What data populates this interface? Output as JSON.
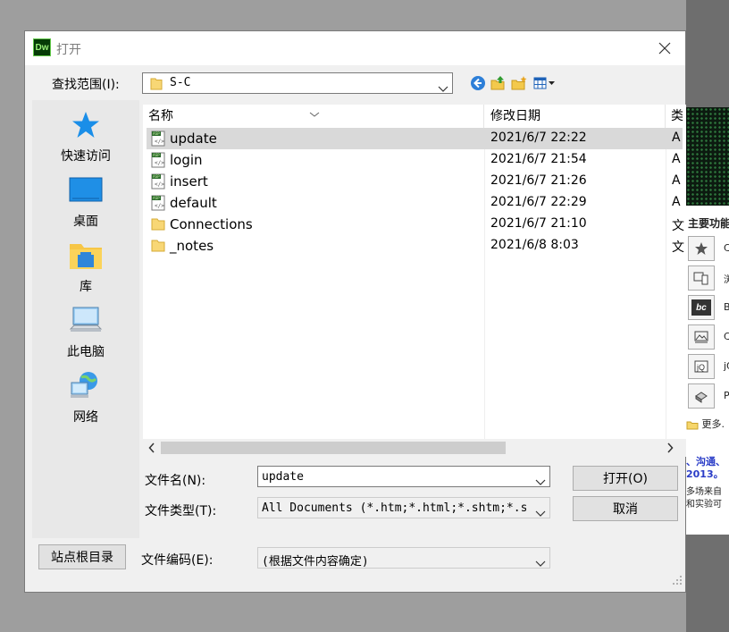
{
  "dialog": {
    "logo_text": "Dw",
    "title": "打开",
    "look_in_label": "查找范围(I):",
    "look_in_value": "S-C",
    "places": [
      {
        "label": "快速访问",
        "icon": "star-icon"
      },
      {
        "label": "桌面",
        "icon": "desktop-icon"
      },
      {
        "label": "库",
        "icon": "library-icon"
      },
      {
        "label": "此电脑",
        "icon": "computer-icon"
      },
      {
        "label": "网络",
        "icon": "network-icon"
      }
    ],
    "columns": {
      "name": "名称",
      "modified": "修改日期",
      "type": "类"
    },
    "files": [
      {
        "name": "update",
        "date": "2021/6/7 22:22",
        "type": "A",
        "kind": "asp-file",
        "selected": true
      },
      {
        "name": "login",
        "date": "2021/6/7 21:54",
        "type": "A",
        "kind": "asp-file",
        "selected": false
      },
      {
        "name": "insert",
        "date": "2021/6/7 21:26",
        "type": "A",
        "kind": "asp-file",
        "selected": false
      },
      {
        "name": "default",
        "date": "2021/6/7 22:29",
        "type": "A",
        "kind": "asp-file",
        "selected": false
      },
      {
        "name": "Connections",
        "date": "2021/6/7 21:10",
        "type": "文",
        "kind": "folder",
        "selected": false
      },
      {
        "name": "_notes",
        "date": "2021/6/8 8:03",
        "type": "文",
        "kind": "folder",
        "selected": false
      }
    ],
    "filename_label": "文件名(N):",
    "filename_value": "update",
    "filetype_label": "文件类型(T):",
    "filetype_value": "All Documents (*.htm;*.html;*.shtm;*.s",
    "encoding_label": "文件编码(E):",
    "encoding_value": "(根据文件内容确定)",
    "open_button": "打开(O)",
    "cancel_button": "取消",
    "site_root_button": "站点根目录"
  },
  "background_app": {
    "panel_title": "主要功能",
    "items": [
      "C",
      "浏",
      "B",
      "C",
      "jQ",
      "P"
    ],
    "more_label": "更多.",
    "link_text": "、沟通、",
    "year_text": "2013。",
    "text_line1": "多场来自",
    "text_line2": "和实验可"
  },
  "colors": {
    "selection": "#d9d9d9",
    "link": "#2a3cc7",
    "accent": "#0078d7"
  }
}
